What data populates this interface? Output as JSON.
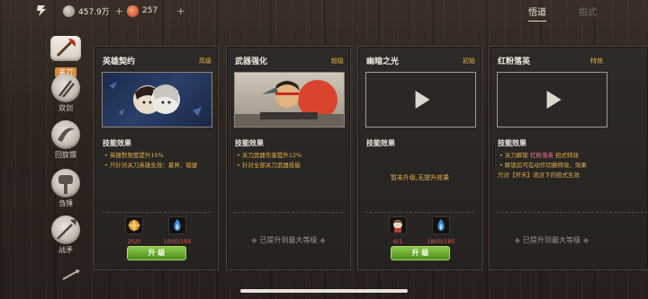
{
  "header": {
    "silver_amount": "457.9万",
    "gourd_amount": "257",
    "plus": "+",
    "tabs": [
      {
        "label": "悟道",
        "active": true
      },
      {
        "label": "招式",
        "active": false
      }
    ]
  },
  "sidenav": {
    "items": [
      {
        "label": "关刀",
        "icon": "guandao-icon",
        "active": true
      },
      {
        "label": "双剑",
        "icon": "twin-sword-icon",
        "active": false
      },
      {
        "label": "回旋镖",
        "icon": "boomerang-icon",
        "active": false
      },
      {
        "label": "刍锤",
        "icon": "hammer-icon",
        "active": false
      },
      {
        "label": "战矛",
        "icon": "spear-icon",
        "active": false
      }
    ]
  },
  "cards": [
    {
      "title": "英雄契约",
      "grade": "高级",
      "section": "技能效果",
      "effects": [
        "• 英雄默契度提升10%",
        "• 只针对关刀英雄生效：夏昇、璇瑟"
      ],
      "materials": [
        {
          "icon": "badge-icon",
          "count": "25/0"
        },
        {
          "icon": "flame-icon",
          "count": "1000/195"
        }
      ],
      "button": "升 级"
    },
    {
      "title": "武器强化",
      "grade": "超级",
      "section": "技能效果",
      "effects": [
        "• 关刀武器伤害提升12%",
        "• 针对全部关刀武器技能"
      ],
      "maxed": "已提升到最大等级"
    },
    {
      "title": "幽暗之光",
      "grade": "初始",
      "section": "技能效果",
      "note": "暂未升级,无提升效果",
      "materials": [
        {
          "icon": "hero-token-icon",
          "count": "6/1"
        },
        {
          "icon": "flame-icon",
          "count": "1800/195"
        }
      ],
      "button": "升 级"
    },
    {
      "title": "红粉落英",
      "grade": "特效",
      "section": "技能效果",
      "effects": [
        {
          "pre": "• 关刀解锁 ",
          "highlight": "红粉落英",
          "post": " 招式特效"
        },
        {
          "pre": "• 解锁后可在动作切换特效，效果",
          "highlight": "",
          "post": ""
        },
        {
          "pre": "只对【开天】流派下的招式生效",
          "highlight": "",
          "post": ""
        }
      ],
      "maxed": "已提升到最大等级"
    }
  ],
  "colors": {
    "accent": "#e5b04a",
    "button_green": "#6fae32",
    "pink": "#f07a96"
  }
}
